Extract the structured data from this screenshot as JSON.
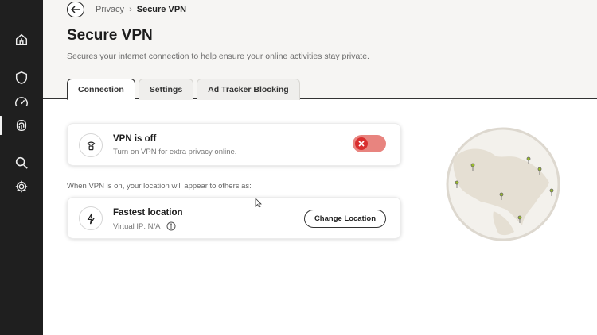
{
  "breadcrumb": {
    "parent": "Privacy",
    "separator": "›",
    "current": "Secure VPN"
  },
  "page": {
    "title": "Secure VPN",
    "subtitle": "Secures your internet connection to help ensure your online activities stay private."
  },
  "tabs": [
    {
      "label": "Connection",
      "active": true
    },
    {
      "label": "Settings",
      "active": false
    },
    {
      "label": "Ad Tracker Blocking",
      "active": false
    }
  ],
  "vpn_card": {
    "title": "VPN is off",
    "description": "Turn on VPN for extra privacy online.",
    "toggle_state": "off",
    "toggle_color": "#d92e2e"
  },
  "location_note": "When VPN is on, your location will appear to others as:",
  "location_card": {
    "title": "Fastest location",
    "virtual_ip": "Virtual IP: N/A",
    "button_label": "Change Location"
  },
  "sidebar": {
    "items": [
      {
        "icon": "home-shield-icon"
      },
      {
        "icon": "shield-icon"
      },
      {
        "icon": "speedometer-icon"
      },
      {
        "icon": "fingerprint-icon",
        "active": true
      },
      {
        "icon": "search-icon"
      },
      {
        "icon": "gear-icon"
      }
    ]
  },
  "colors": {
    "rail": "#1f1f1f",
    "header_bg": "#f6f5f3",
    "toggle_track": "#e8847f",
    "globe_land": "#e8e2d6",
    "pin": "#9bbe2a"
  }
}
